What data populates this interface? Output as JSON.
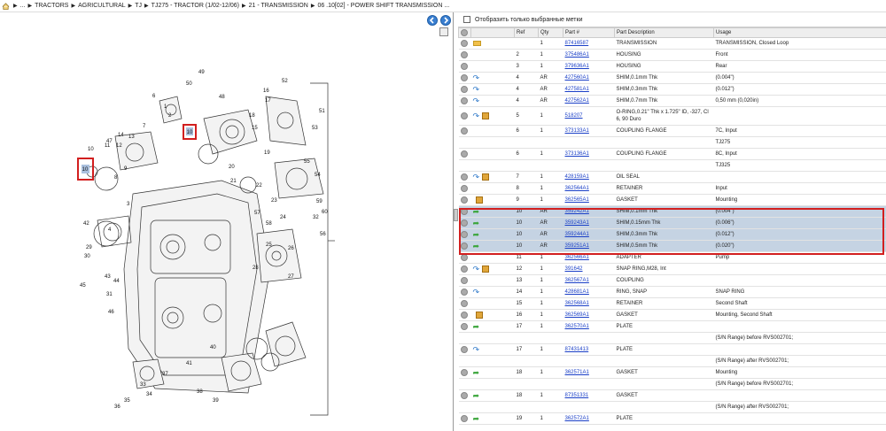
{
  "breadcrumb": [
    "...",
    "TRACTORS",
    "AGRICULTURAL",
    "TJ",
    "TJ275 - TRACTOR (1/02-12/06)",
    "21 - TRANSMISSION",
    "06 .10[02] - POWER SHIFT TRANSMISSION ..."
  ],
  "filter_label": "Отобразить только выбранные метки",
  "columns": [
    "Ref",
    "Qty",
    "Part #",
    "Part Description",
    "Usage"
  ],
  "diagram_callouts": [
    "10",
    "10"
  ],
  "rows": [
    {
      "ref": "",
      "qty": "1",
      "part": "87416587",
      "desc": "TRANSMISSION",
      "usage": "TRANSMISSION, Closed Loop",
      "icons": [
        "gear",
        "folder"
      ]
    },
    {
      "ref": "2",
      "qty": "1",
      "part": "375486A1",
      "desc": "HOUSING",
      "usage": "Front",
      "icons": [
        "gear"
      ]
    },
    {
      "ref": "3",
      "qty": "1",
      "part": "379636A1",
      "desc": "HOUSING",
      "usage": "Rear",
      "icons": [
        "gear"
      ]
    },
    {
      "ref": "4",
      "qty": "AR",
      "part": "427560A1",
      "desc": "SHIM,0.1mm Thk",
      "usage": "(0.004\")",
      "icons": [
        "gear",
        "arrow-b"
      ]
    },
    {
      "ref": "4",
      "qty": "AR",
      "part": "427581A1",
      "desc": "SHIM,0.3mm Thk",
      "usage": "(0.012\")",
      "icons": [
        "gear",
        "arrow-b"
      ]
    },
    {
      "ref": "4",
      "qty": "AR",
      "part": "427562A1",
      "desc": "SHIM,0.7mm Thk",
      "usage": "0,50 mm (0,020in)",
      "icons": [
        "gear",
        "arrow-b"
      ]
    },
    {
      "ref": "5",
      "qty": "1",
      "part": "518207",
      "desc": "O-RING,0.21\" Thk x 1.725\" ID, -327, Cl 6, 90 Duro",
      "usage": "",
      "icons": [
        "gear",
        "arrow-b",
        "box"
      ],
      "tall": true
    },
    {
      "ref": "6",
      "qty": "1",
      "part": "373133A1",
      "desc": "COUPLING FLANGE",
      "usage": "7C, Input",
      "icons": [
        "gear"
      ]
    },
    {
      "ref": "",
      "qty": "",
      "part": "",
      "desc": "",
      "usage": "TJ275",
      "icons": [],
      "sub": true
    },
    {
      "ref": "6",
      "qty": "1",
      "part": "373136A1",
      "desc": "COUPLING FLANGE",
      "usage": "8C, Input",
      "icons": [
        "gear"
      ]
    },
    {
      "ref": "",
      "qty": "",
      "part": "",
      "desc": "",
      "usage": "TJ325",
      "icons": [],
      "sub": true
    },
    {
      "ref": "7",
      "qty": "1",
      "part": "428159A1",
      "desc": "OIL SEAL",
      "usage": "",
      "icons": [
        "gear",
        "arrow-b",
        "box"
      ]
    },
    {
      "ref": "8",
      "qty": "1",
      "part": "362564A1",
      "desc": "RETAINER",
      "usage": "Input",
      "icons": [
        "gear"
      ]
    },
    {
      "ref": "9",
      "qty": "1",
      "part": "362565A1",
      "desc": "GASKET",
      "usage": "Mounting",
      "icons": [
        "gear",
        "box"
      ]
    },
    {
      "ref": "10",
      "qty": "AR",
      "part": "359242A1",
      "desc": "SHIM,0.1mm Thk",
      "usage": "(0.004\")",
      "icons": [
        "gear",
        "arrow-g"
      ],
      "hl": true
    },
    {
      "ref": "10",
      "qty": "AR",
      "part": "359243A1",
      "desc": "SHIM,0.15mm Thk",
      "usage": "(0.006\")",
      "icons": [
        "gear",
        "arrow-g"
      ],
      "hl": true
    },
    {
      "ref": "10",
      "qty": "AR",
      "part": "359244A1",
      "desc": "SHIM,0.3mm Thk",
      "usage": "(0.012\")",
      "icons": [
        "gear",
        "arrow-g"
      ],
      "hl": true
    },
    {
      "ref": "10",
      "qty": "AR",
      "part": "359251A1",
      "desc": "SHIM,0.5mm Thk",
      "usage": "(0.020\")",
      "icons": [
        "gear",
        "arrow-g"
      ],
      "hl": true
    },
    {
      "ref": "11",
      "qty": "1",
      "part": "362566A1",
      "desc": "ADAPTER",
      "usage": "Pump",
      "icons": [
        "gear"
      ]
    },
    {
      "ref": "12",
      "qty": "1",
      "part": "391642",
      "desc": "SNAP RING,M28, Int",
      "usage": "",
      "icons": [
        "gear",
        "arrow-b",
        "box"
      ]
    },
    {
      "ref": "13",
      "qty": "1",
      "part": "362567A1",
      "desc": "COUPLING",
      "usage": "",
      "icons": [
        "gear"
      ]
    },
    {
      "ref": "14",
      "qty": "1",
      "part": "428681A1",
      "desc": "RING, SNAP",
      "usage": "SNAP RING",
      "icons": [
        "gear",
        "arrow-b"
      ]
    },
    {
      "ref": "15",
      "qty": "1",
      "part": "362568A1",
      "desc": "RETAINER",
      "usage": "Second Shaft",
      "icons": [
        "gear"
      ]
    },
    {
      "ref": "16",
      "qty": "1",
      "part": "362569A1",
      "desc": "GASKET",
      "usage": "Mounting, Second Shaft",
      "icons": [
        "gear",
        "box"
      ]
    },
    {
      "ref": "17",
      "qty": "1",
      "part": "362570A1",
      "desc": "PLATE",
      "usage": "",
      "icons": [
        "gear",
        "arrow-g"
      ]
    },
    {
      "ref": "",
      "qty": "",
      "part": "",
      "desc": "",
      "usage": "(S/N Range) before RVS002701;",
      "icons": [],
      "sub": true
    },
    {
      "ref": "17",
      "qty": "1",
      "part": "87431413",
      "desc": "PLATE",
      "usage": "",
      "icons": [
        "gear",
        "arrow-b"
      ]
    },
    {
      "ref": "",
      "qty": "",
      "part": "",
      "desc": "",
      "usage": "(S/N Range) after RVS002701;",
      "icons": [],
      "sub": true
    },
    {
      "ref": "18",
      "qty": "1",
      "part": "362571A1",
      "desc": "GASKET",
      "usage": "Mounting",
      "icons": [
        "gear",
        "arrow-g"
      ]
    },
    {
      "ref": "",
      "qty": "",
      "part": "",
      "desc": "",
      "usage": "(S/N Range) before RVS002701;",
      "icons": [],
      "sub": true
    },
    {
      "ref": "18",
      "qty": "1",
      "part": "87351331",
      "desc": "GASKET",
      "usage": "",
      "icons": [
        "gear",
        "arrow-g"
      ]
    },
    {
      "ref": "",
      "qty": "",
      "part": "",
      "desc": "",
      "usage": "(S/N Range) after RVS002701;",
      "icons": [],
      "sub": true
    },
    {
      "ref": "19",
      "qty": "1",
      "part": "362572A1",
      "desc": "PLATE",
      "usage": "",
      "icons": [
        "gear",
        "arrow-g"
      ]
    }
  ],
  "diagram_numbers": [
    "49",
    "50",
    "6",
    "1",
    "2",
    "7",
    "14",
    "13",
    "12",
    "11",
    "47",
    "10",
    "9",
    "8",
    "48",
    "52",
    "51",
    "53",
    "55",
    "54",
    "32",
    "3",
    "42",
    "43",
    "44",
    "45",
    "46",
    "40",
    "41",
    "33",
    "34",
    "35",
    "36",
    "37",
    "38",
    "39",
    "56",
    "57",
    "58",
    "59",
    "60",
    "29",
    "30",
    "31",
    "4",
    "16",
    "17",
    "18",
    "15",
    "19",
    "20",
    "21",
    "22",
    "23",
    "24",
    "25",
    "26",
    "27",
    "28"
  ]
}
